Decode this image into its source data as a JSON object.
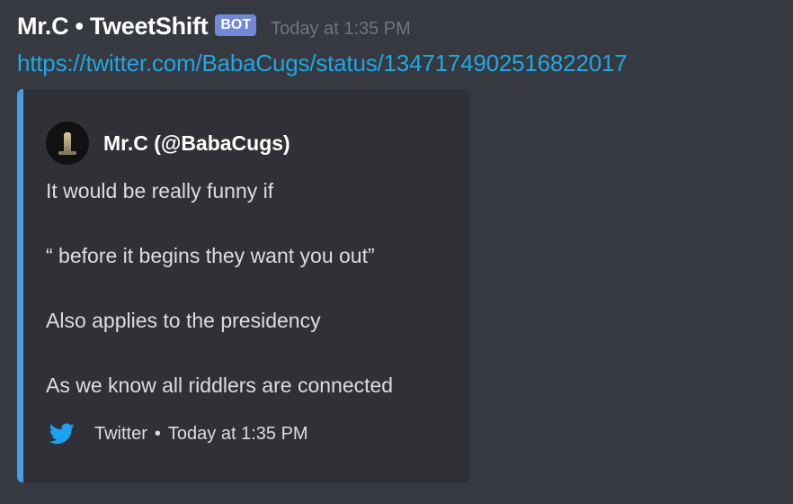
{
  "message": {
    "author": "Mr.C • TweetShift",
    "bot_tag": "BOT",
    "timestamp": "Today at 1:35 PM",
    "link": "https://twitter.com/BabaCugs/status/1347174902516822017"
  },
  "embed": {
    "accent_color": "#4a9ee6",
    "author_name": "Mr.C (@BabaCugs)",
    "description_lines": [
      "It would be really funny if",
      "“ before it begins they want you out”",
      "Also applies to the presidency",
      "As we know all riddlers are connected"
    ],
    "footer": {
      "icon": "twitter-bird-icon",
      "text": "Twitter",
      "separator": "•",
      "timestamp": "Today at 1:35 PM"
    }
  },
  "colors": {
    "background": "#36393f",
    "embed_background": "#2f3136",
    "link": "#1ea8e6",
    "bot_tag": "#7289da",
    "twitter_blue": "#1da1f2"
  }
}
